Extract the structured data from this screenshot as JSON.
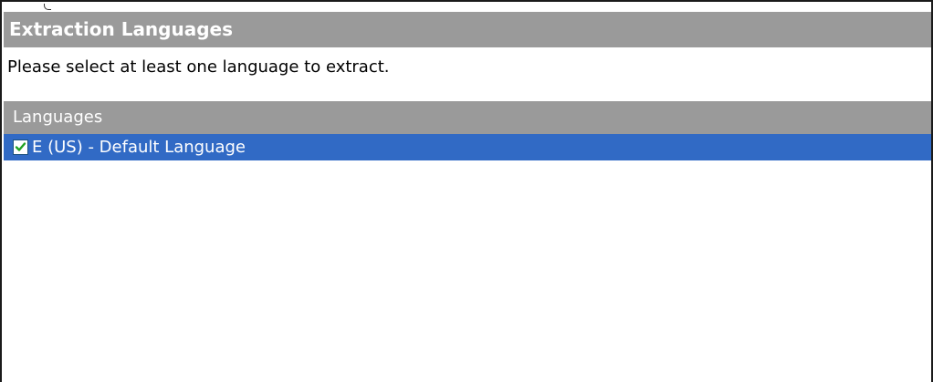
{
  "panel": {
    "title": "Extraction Languages",
    "instruction": "Please select at least one language to extract."
  },
  "languages": {
    "header": "Languages",
    "items": [
      {
        "label": "E (US) - Default Language",
        "checked": true,
        "selected": true
      }
    ]
  },
  "colors": {
    "header_bg": "#9a9a9a",
    "selection_bg": "#316ac5",
    "check_mark": "#21a121"
  },
  "icons": {
    "checkbox": "checkbox-checked-icon"
  }
}
